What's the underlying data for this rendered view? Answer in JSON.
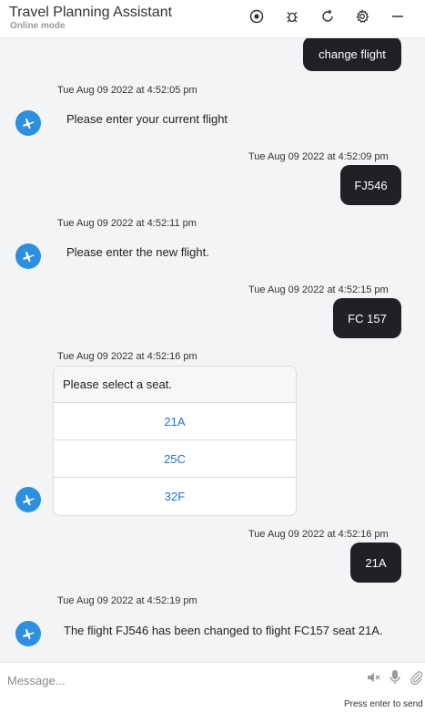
{
  "header": {
    "title": "Travel Planning Assistant",
    "subtitle": "Online mode",
    "icons": [
      "record-icon",
      "bug-icon",
      "refresh-icon",
      "gear-icon",
      "minimize-icon"
    ]
  },
  "messages": {
    "m0": {
      "text": "change flight"
    },
    "m1": {
      "time": "Tue Aug 09 2022 at 4:52:05 pm",
      "text": "Please enter your current flight"
    },
    "m2": {
      "time": "Tue Aug 09 2022 at 4:52:09 pm",
      "text": "FJ546"
    },
    "m3": {
      "time": "Tue Aug 09 2022 at 4:52:11 pm",
      "text": "Please enter the new flight."
    },
    "m4": {
      "time": "Tue Aug 09 2022 at 4:52:15 pm",
      "text": "FC 157"
    },
    "m5": {
      "time": "Tue Aug 09 2022 at 4:52:16 pm",
      "text": "Please select a seat.",
      "options": [
        "21A",
        "25C",
        "32F"
      ]
    },
    "m6": {
      "time": "Tue Aug 09 2022 at 4:52:16 pm",
      "text": "21A"
    },
    "m7": {
      "time": "Tue Aug 09 2022 at 4:52:19 pm",
      "text": "The flight FJ546 has been changed to flight FC157 seat 21A."
    }
  },
  "composer": {
    "placeholder": "Message...",
    "hint": "Press enter to send"
  },
  "colors": {
    "chat_bg": "#f3f4f6",
    "user_bubble": "#1f2124",
    "avatar": "#2d8fe0",
    "option_link": "#1f73d6"
  }
}
